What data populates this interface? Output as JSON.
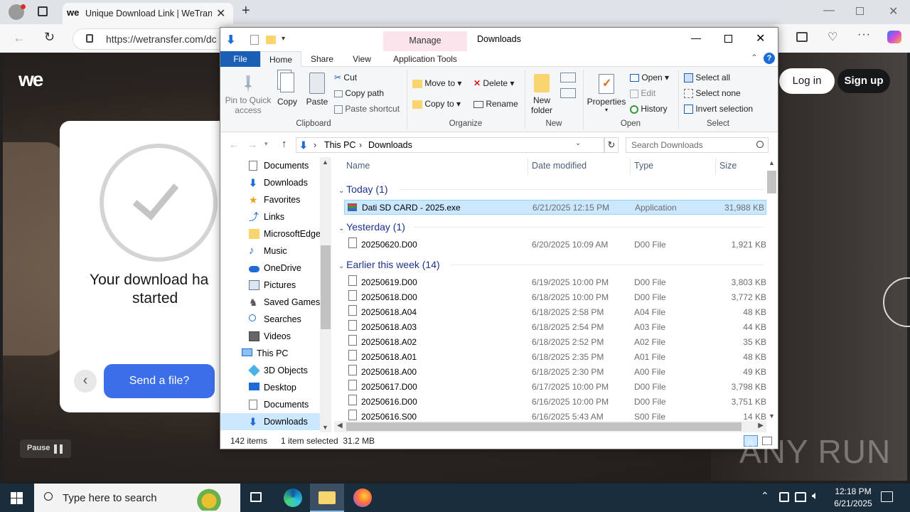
{
  "browser": {
    "tab_title": "Unique Download Link | WeTransf",
    "url": "https://wetransfer.com/dc",
    "colors": {
      "accent": "#0a5cbf"
    }
  },
  "wetransfer": {
    "logo": "we",
    "login": "Log in",
    "signup": "Sign up",
    "download_msg_line1": "Your download ha",
    "download_msg_line2": "started",
    "send_button": "Send a file?",
    "pause_label": "Pause",
    "colors": {
      "send": "#3b6ee8",
      "signup": "#17181a"
    }
  },
  "explorer": {
    "window_title": "Downloads",
    "manage_tab": "Manage",
    "app_tools_tab": "Application Tools",
    "ribbon_tabs": [
      "File",
      "Home",
      "Share",
      "View"
    ],
    "clipboard": {
      "pin": "Pin to Quick",
      "pin2": "access",
      "copy": "Copy",
      "paste": "Paste",
      "cut": "Cut",
      "copy_path": "Copy path",
      "paste_shortcut": "Paste shortcut",
      "label": "Clipboard"
    },
    "organize": {
      "move_to": "Move to",
      "copy_to": "Copy to",
      "delete": "Delete",
      "rename": "Rename",
      "label": "Organize"
    },
    "new": {
      "new_folder": "New",
      "new_folder2": "folder",
      "label": "New"
    },
    "open": {
      "properties": "Properties",
      "open": "Open",
      "edit": "Edit",
      "history": "History",
      "label": "Open"
    },
    "select": {
      "select_all": "Select all",
      "select_none": "Select none",
      "invert": "Invert selection",
      "label": "Select"
    },
    "breadcrumb": [
      "This PC",
      "Downloads"
    ],
    "search_placeholder": "Search Downloads",
    "nav": [
      "Documents",
      "Downloads",
      "Favorites",
      "Links",
      "MicrosoftEdge",
      "Music",
      "OneDrive",
      "Pictures",
      "Saved Games",
      "Searches",
      "Videos",
      "This PC",
      "3D Objects",
      "Desktop",
      "Documents",
      "Downloads"
    ],
    "columns": {
      "name": "Name",
      "date": "Date modified",
      "type": "Type",
      "size": "Size"
    },
    "groups": {
      "today": "Today (1)",
      "yesterday": "Yesterday (1)",
      "earlier": "Earlier this week (14)"
    },
    "today_files": [
      {
        "name": "Dati SD CARD - 2025.exe",
        "date": "6/21/2025 12:15 PM",
        "type": "Application",
        "size": "31,988 KB"
      }
    ],
    "yesterday_files": [
      {
        "name": "20250620.D00",
        "date": "6/20/2025 10:09 AM",
        "type": "D00 File",
        "size": "1,921 KB"
      }
    ],
    "earlier_files": [
      {
        "name": "20250619.D00",
        "date": "6/19/2025 10:00 PM",
        "type": "D00 File",
        "size": "3,803 KB"
      },
      {
        "name": "20250618.D00",
        "date": "6/18/2025 10:00 PM",
        "type": "D00 File",
        "size": "3,772 KB"
      },
      {
        "name": "20250618.A04",
        "date": "6/18/2025 2:58 PM",
        "type": "A04 File",
        "size": "48 KB"
      },
      {
        "name": "20250618.A03",
        "date": "6/18/2025 2:54 PM",
        "type": "A03 File",
        "size": "44 KB"
      },
      {
        "name": "20250618.A02",
        "date": "6/18/2025 2:52 PM",
        "type": "A02 File",
        "size": "35 KB"
      },
      {
        "name": "20250618.A01",
        "date": "6/18/2025 2:35 PM",
        "type": "A01 File",
        "size": "48 KB"
      },
      {
        "name": "20250618.A00",
        "date": "6/18/2025 2:30 PM",
        "type": "A00 File",
        "size": "49 KB"
      },
      {
        "name": "20250617.D00",
        "date": "6/17/2025 10:00 PM",
        "type": "D00 File",
        "size": "3,798 KB"
      },
      {
        "name": "20250616.D00",
        "date": "6/16/2025 10:00 PM",
        "type": "D00 File",
        "size": "3,751 KB"
      },
      {
        "name": "20250616.S00",
        "date": "6/16/2025 5:43 AM",
        "type": "S00 File",
        "size": "14 KB"
      }
    ],
    "status_items": "142 items",
    "status_selected": "1 item selected  31.2 MB"
  },
  "taskbar": {
    "search_placeholder": "Type here to search",
    "time": "12:18 PM",
    "date": "6/21/2025"
  },
  "watermark": "ANY RUN"
}
